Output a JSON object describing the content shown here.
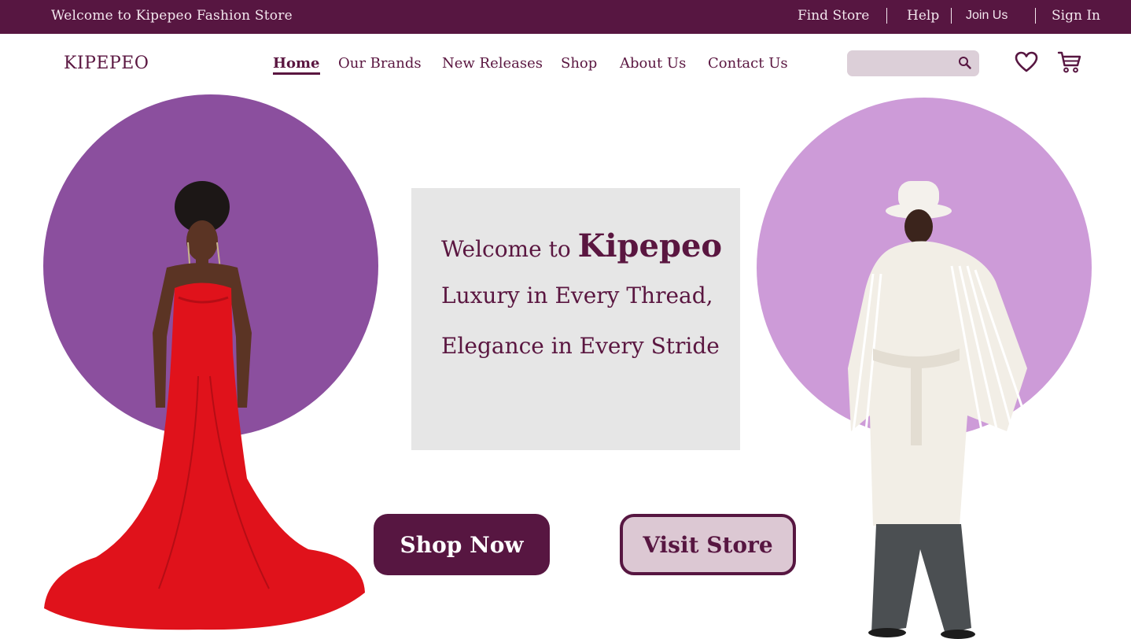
{
  "topbar": {
    "welcome": "Welcome to Kipepeo Fashion Store",
    "find_store": "Find Store",
    "help": "Help",
    "join_us": "Join Us",
    "sign_in": "Sign In"
  },
  "header": {
    "logo": "KIPEPEO",
    "nav": [
      "Home",
      "Our Brands",
      "New Releases",
      "Shop",
      "About Us",
      "Contact Us"
    ],
    "active_nav": "Home",
    "search_placeholder": "",
    "icons": [
      "search-icon",
      "heart-icon",
      "cart-icon"
    ]
  },
  "hero": {
    "welcome_prefix": "Welcome to ",
    "brand": "Kipepeo",
    "tagline_1": "Luxury in Every Thread,",
    "tagline_2": "Elegance in Every Stride",
    "shop_now": "Shop Now",
    "visit_store": "Visit Store"
  },
  "colors": {
    "primary": "#571641",
    "circle_left": "#8b4f9e",
    "circle_right": "#cd9bd8",
    "box": "#e6e6e6",
    "search_bg": "#dccfd8"
  }
}
